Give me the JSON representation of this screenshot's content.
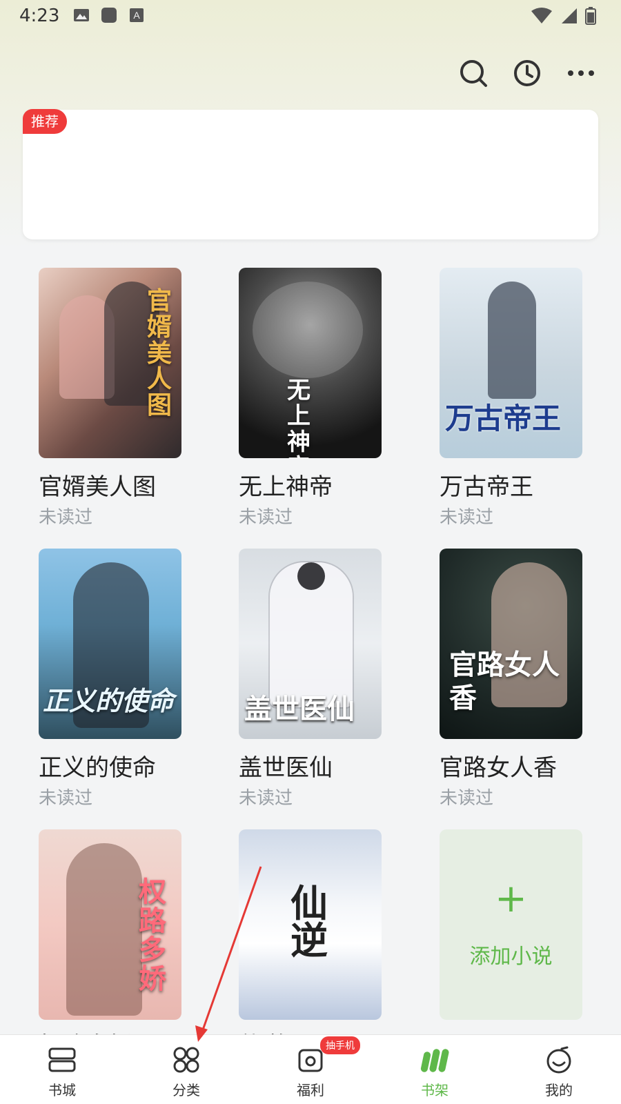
{
  "status_bar": {
    "time": "4:23"
  },
  "header": {
    "icons": [
      "search-icon",
      "history-icon",
      "more-icon"
    ]
  },
  "recommend": {
    "badge": "推荐"
  },
  "books": [
    {
      "title": "官婿美人图",
      "status": "未读过",
      "cover_text": "官婿美人图"
    },
    {
      "title": "无上神帝",
      "status": "未读过",
      "cover_text": "无上神帝"
    },
    {
      "title": "万古帝王",
      "status": "未读过",
      "cover_text": "万古帝王"
    },
    {
      "title": "正义的使命",
      "status": "未读过",
      "cover_text": "正义的使命"
    },
    {
      "title": "盖世医仙",
      "status": "未读过",
      "cover_text": "盖世医仙"
    },
    {
      "title": "官路女人香",
      "status": "未读过",
      "cover_text": "官路女人香"
    },
    {
      "title": "权路多娇",
      "cover_text": "权路多娇"
    },
    {
      "title": "仙逆",
      "cover_text": "仙逆"
    }
  ],
  "add_card": {
    "label": "添加小说",
    "plus": "+"
  },
  "bottom_nav": {
    "items": [
      {
        "label": "书城",
        "icon": "bookstore-icon"
      },
      {
        "label": "分类",
        "icon": "category-icon"
      },
      {
        "label": "福利",
        "icon": "welfare-icon",
        "badge": "抽手机"
      },
      {
        "label": "书架",
        "icon": "bookshelf-icon",
        "active": true
      },
      {
        "label": "我的",
        "icon": "profile-icon"
      }
    ]
  },
  "colors": {
    "accent": "#5fb84a",
    "badge_red": "#ef3b3b"
  }
}
